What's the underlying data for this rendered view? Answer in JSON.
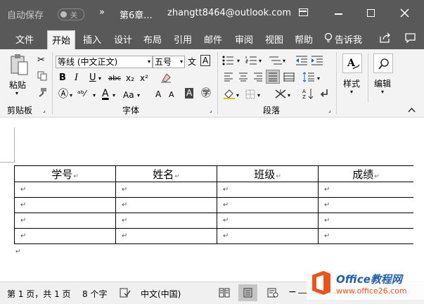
{
  "titlebar": {
    "autosave": "自动保存",
    "autosave_state": "关",
    "arrow": "»",
    "doc_title": "第6章...",
    "account": "zhangtt8464@outlook.com",
    "ribbon_display_icon": "ribbon-display-options-icon",
    "minimize_icon": "minimize-icon",
    "maximize_icon": "maximize-icon",
    "close_icon": "close-icon"
  },
  "tabs": [
    "文件",
    "开始",
    "插入",
    "设计",
    "布局",
    "引用",
    "邮件",
    "审阅",
    "视图",
    "帮助"
  ],
  "tellme": "告诉我",
  "ribbon": {
    "clipboard": {
      "paste": "粘贴",
      "label": "剪贴板"
    },
    "font": {
      "font_name": "等线 (中文正文)",
      "font_size": "五号",
      "bold": "B",
      "italic": "I",
      "underline": "U",
      "strike": "abc",
      "subscript": "x₂",
      "superscript": "x²",
      "font_color": "A",
      "change_case": "Aa",
      "grow": "A",
      "shrink": "A",
      "phonetic": "文",
      "border_char": "A",
      "label": "字体"
    },
    "paragraph": {
      "label": "段落"
    },
    "styles": {
      "label": "样式"
    },
    "editing": {
      "label": "编辑"
    }
  },
  "table": {
    "headers": [
      "学号",
      "姓名",
      "班级",
      "成绩"
    ],
    "mark": "↵",
    "rows": 4
  },
  "statusbar": {
    "page": "第 1 页，共 1 页",
    "words": "8 个字",
    "language": "中文(中国)"
  },
  "watermark": {
    "brand": "Office教程网",
    "url": "www.office26.com"
  }
}
